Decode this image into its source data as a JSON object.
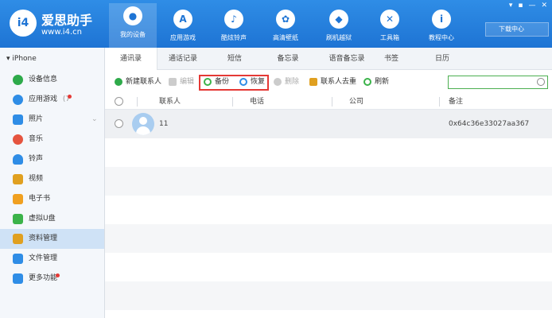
{
  "brand": {
    "name": "爱思助手",
    "url": "www.i4.cn",
    "logo_text": "i4"
  },
  "window_controls": [
    "▾",
    "▪",
    "—",
    "✕"
  ],
  "nav": [
    {
      "label": "我的设备",
      "icon": "apple-icon",
      "glyph": "",
      "active": true
    },
    {
      "label": "应用游戏",
      "icon": "appstore-icon",
      "glyph": "A"
    },
    {
      "label": "酷炫铃声",
      "icon": "bell-icon",
      "glyph": "♪"
    },
    {
      "label": "高清壁纸",
      "icon": "flower-icon",
      "glyph": "✿"
    },
    {
      "label": "刷机越狱",
      "icon": "dropbox-icon",
      "glyph": "◆"
    },
    {
      "label": "工具箱",
      "icon": "tools-icon",
      "glyph": "✕"
    },
    {
      "label": "教程中心",
      "icon": "info-icon",
      "glyph": "i"
    }
  ],
  "download_center": "下载中心",
  "sidebar": {
    "device": "iPhone",
    "items": [
      {
        "label": "设备信息",
        "icon": "info-icon",
        "color": "#2eaa4a"
      },
      {
        "label": "应用游戏",
        "icon": "appstore-icon",
        "color": "#2f8de6",
        "count": "(7",
        "dot": true
      },
      {
        "label": "照片",
        "icon": "photo-icon",
        "color": "#2f8de6"
      },
      {
        "label": "音乐",
        "icon": "music-icon",
        "color": "#e5543f"
      },
      {
        "label": "铃声",
        "icon": "bell-icon",
        "color": "#2f8de6"
      },
      {
        "label": "视频",
        "icon": "video-icon",
        "color": "#e0a020"
      },
      {
        "label": "电子书",
        "icon": "book-icon",
        "color": "#f0a020"
      },
      {
        "label": "虚拟U盘",
        "icon": "usb-icon",
        "color": "#3bb34a"
      },
      {
        "label": "资料管理",
        "icon": "data-icon",
        "color": "#e0a020",
        "active": true
      },
      {
        "label": "文件管理",
        "icon": "folder-icon",
        "color": "#2f8de6"
      },
      {
        "label": "更多功能",
        "icon": "grid-icon",
        "color": "#2f8de6",
        "dot": true
      }
    ]
  },
  "tabs": [
    "通讯录",
    "通话记录",
    "短信",
    "备忘录",
    "语音备忘录",
    "书签",
    "日历"
  ],
  "toolbar": {
    "new_contact": "新建联系人",
    "edit": "编辑",
    "backup": "备份",
    "restore": "恢复",
    "delete": "删除",
    "dedupe": "联系人去重",
    "refresh": "刷新"
  },
  "search": {
    "placeholder": ""
  },
  "table": {
    "columns": [
      "联系人",
      "电话",
      "公司",
      "备注"
    ],
    "rows": [
      {
        "name": "11",
        "phone": "",
        "company": "",
        "note": "0x64c36e33027aa367"
      }
    ]
  },
  "colors": {
    "accent": "#1e74d4",
    "highlight": "#e53935"
  }
}
